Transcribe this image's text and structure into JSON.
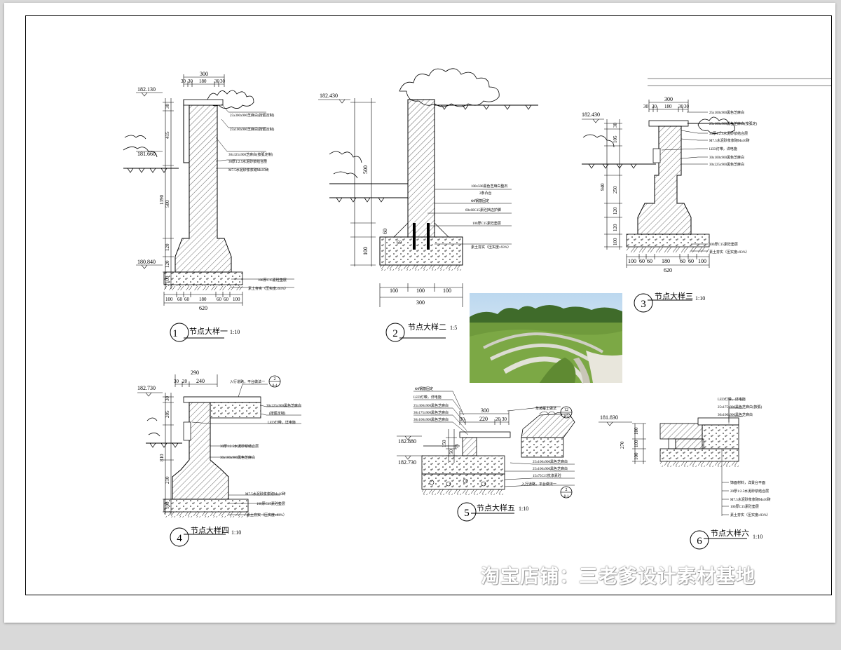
{
  "sheet": {
    "watermark": "淘宝店铺：三老爹设计素材基地"
  },
  "details": [
    {
      "num": "1",
      "title": "节点大样一",
      "scale": "1:10",
      "top_dims": [
        "300",
        "30",
        "30",
        "180",
        "30",
        "30"
      ],
      "bottom_dims": [
        "100",
        "60",
        "60",
        "180",
        "60",
        "60",
        "100"
      ],
      "total": "620",
      "heights": [
        "30",
        "415",
        "1390",
        "500",
        "120",
        "120",
        "100"
      ],
      "elevations": [
        "182.130",
        "181.660",
        "180.840"
      ],
      "notes": [
        "25x300x900芝麻白(按弧定制)",
        "25x100x900芝麻白(按弧定制)",
        "30x325x900芝麻白(按弧定制)",
        "30厚1:2.5水泥砂浆结合层",
        "M7.5水泥砂浆浆砌Mu10砖",
        "100厚C15素砼垫层",
        "素土夯实（压实度≥93%）"
      ]
    },
    {
      "num": "2",
      "title": "节点大样二",
      "scale": "1:5",
      "bottom_dims": [
        "100",
        "100",
        "100"
      ],
      "total": "300",
      "heights": [
        "500",
        "60",
        "100"
      ],
      "dims_inner": [
        "60"
      ],
      "elevations": [
        "182.430"
      ],
      "notes": [
        "100x500黑色芝麻白整石",
        "2条凸台",
        "Φ8钢筋固定",
        "60x60C15素砼挡边护脚",
        "100厚C15素砼垫层",
        "素土夯实（压实度≥93%）"
      ]
    },
    {
      "num": "3",
      "title": "节点大样三",
      "scale": "1:10",
      "top_dims": [
        "300",
        "30",
        "30",
        "180",
        "30",
        "30"
      ],
      "bottom_dims": [
        "100",
        "60",
        "60",
        "180",
        "60",
        "60",
        "100"
      ],
      "total": "620",
      "heights": [
        "30",
        "105",
        "940",
        "250",
        "120",
        "120",
        "100"
      ],
      "elevations": [
        "182.430"
      ],
      "notes": [
        "25x100x900黑色芝麻白",
        "25x100x900黑色芝麻白(按弧定)",
        "30厚1:2.5水泥砂浆结合层",
        "M7.5水泥砂浆浆砌Mu10砖",
        "LED灯带，详电施",
        "30x100x900黑色芝麻白",
        "30x225x900黑色芝麻白",
        "100厚C15素砼垫层",
        "素土夯实（压实度≥93%）"
      ]
    },
    {
      "num": "4",
      "title": "节点大样四",
      "scale": "1:10",
      "top_dims": [
        "290",
        "30",
        "20",
        "240"
      ],
      "heights": [
        "30",
        "205",
        "810",
        "210",
        "100"
      ],
      "elevations": [
        "182.730"
      ],
      "ref": "入行道路，平台做法一",
      "ref_num": "2",
      "ref_den": "8-4",
      "notes": [
        "30x225x900黑色芝麻白",
        "(按弧定制)",
        "LED灯带，详电施",
        "30厚1:2.5水泥砂浆结合层",
        "30x100x900黑色芝麻白",
        "M7.5水泥砂浆浆砌Mu10砖",
        "100厚C15素砼垫层",
        "素土夯实（压实度≥93%）"
      ]
    },
    {
      "num": "5",
      "title": "节点大样五",
      "scale": "1:10",
      "top_dims": [
        "300",
        "30",
        "220",
        "20",
        "30"
      ],
      "heights": [
        "150",
        "75",
        "50"
      ],
      "elevations": [
        "182.880",
        "182.730"
      ],
      "notes_left": [
        "Φ8钢筋固定",
        "LED灯带，详电施",
        "25x300x900黑色芝麻白",
        "30x175x900黑色芝麻白",
        "30x100x900黑色芝麻白"
      ],
      "notes_right": [
        "25x100x900黑色芝麻白",
        "25x100x900黑色芝麻白",
        "15x75C15抗渗素砼",
        "入行道路，平台做法一"
      ],
      "ref_top": "草坡覆土做法",
      "ref_top_num": "12",
      "ref_top_den": "8-2",
      "ref_bot_num": "2",
      "ref_bot_den": "8-1"
    },
    {
      "num": "6",
      "title": "节点大样六",
      "scale": "1:10",
      "heights": [
        "270",
        "100",
        "100",
        "100"
      ],
      "elevations": [
        "181.830"
      ],
      "notes_top": [
        "LED灯带，详电施",
        "25x175x900黑色芝麻白(按弧)",
        "30x100x900黑色芝麻白"
      ],
      "notes_bot": [
        "饰面材料，详景台平面",
        "20厚1:2.5水泥砂浆结合层",
        "M7.5水泥砂浆浆砌Mu10砖",
        "100厚C15素砼垫层",
        "素土夯实（压实度≥93%）"
      ]
    }
  ]
}
